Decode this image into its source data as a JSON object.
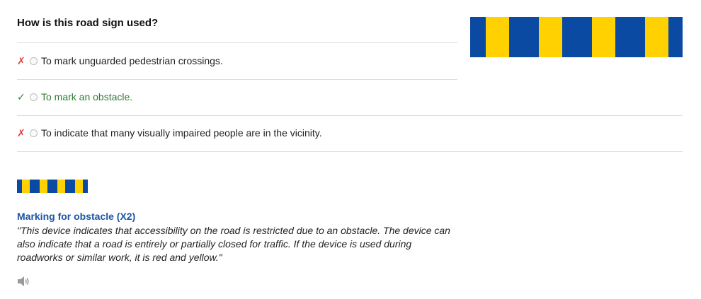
{
  "question": {
    "title": "How is this road sign used?"
  },
  "sign": {
    "name": "Marking for obstacle (X2)",
    "colors": [
      "#0b4aa2",
      "#ffd100"
    ]
  },
  "answers": [
    {
      "text": "To mark unguarded pedestrian crossings.",
      "mark": "✗",
      "status": "incorrect",
      "color": "#e53935"
    },
    {
      "text": "To mark an obstacle.",
      "mark": "✓",
      "status": "correct",
      "color": "#2e7d32"
    },
    {
      "text": "To indicate that many visually impaired people are in the vicinity.",
      "mark": "✗",
      "status": "incorrect",
      "color": "#e53935"
    }
  ],
  "explanation": {
    "title": "Marking for obstacle (X2)",
    "title_color": "#1a56a6",
    "body": "\"This device indicates that accessibility on the road is restricted due to an obstacle. The device can also indicate that a road is entirely or partially closed for traffic. If the device is used during roadworks or similar work, it is red and yellow.\""
  },
  "audio": {
    "icon": "speaker-icon"
  }
}
